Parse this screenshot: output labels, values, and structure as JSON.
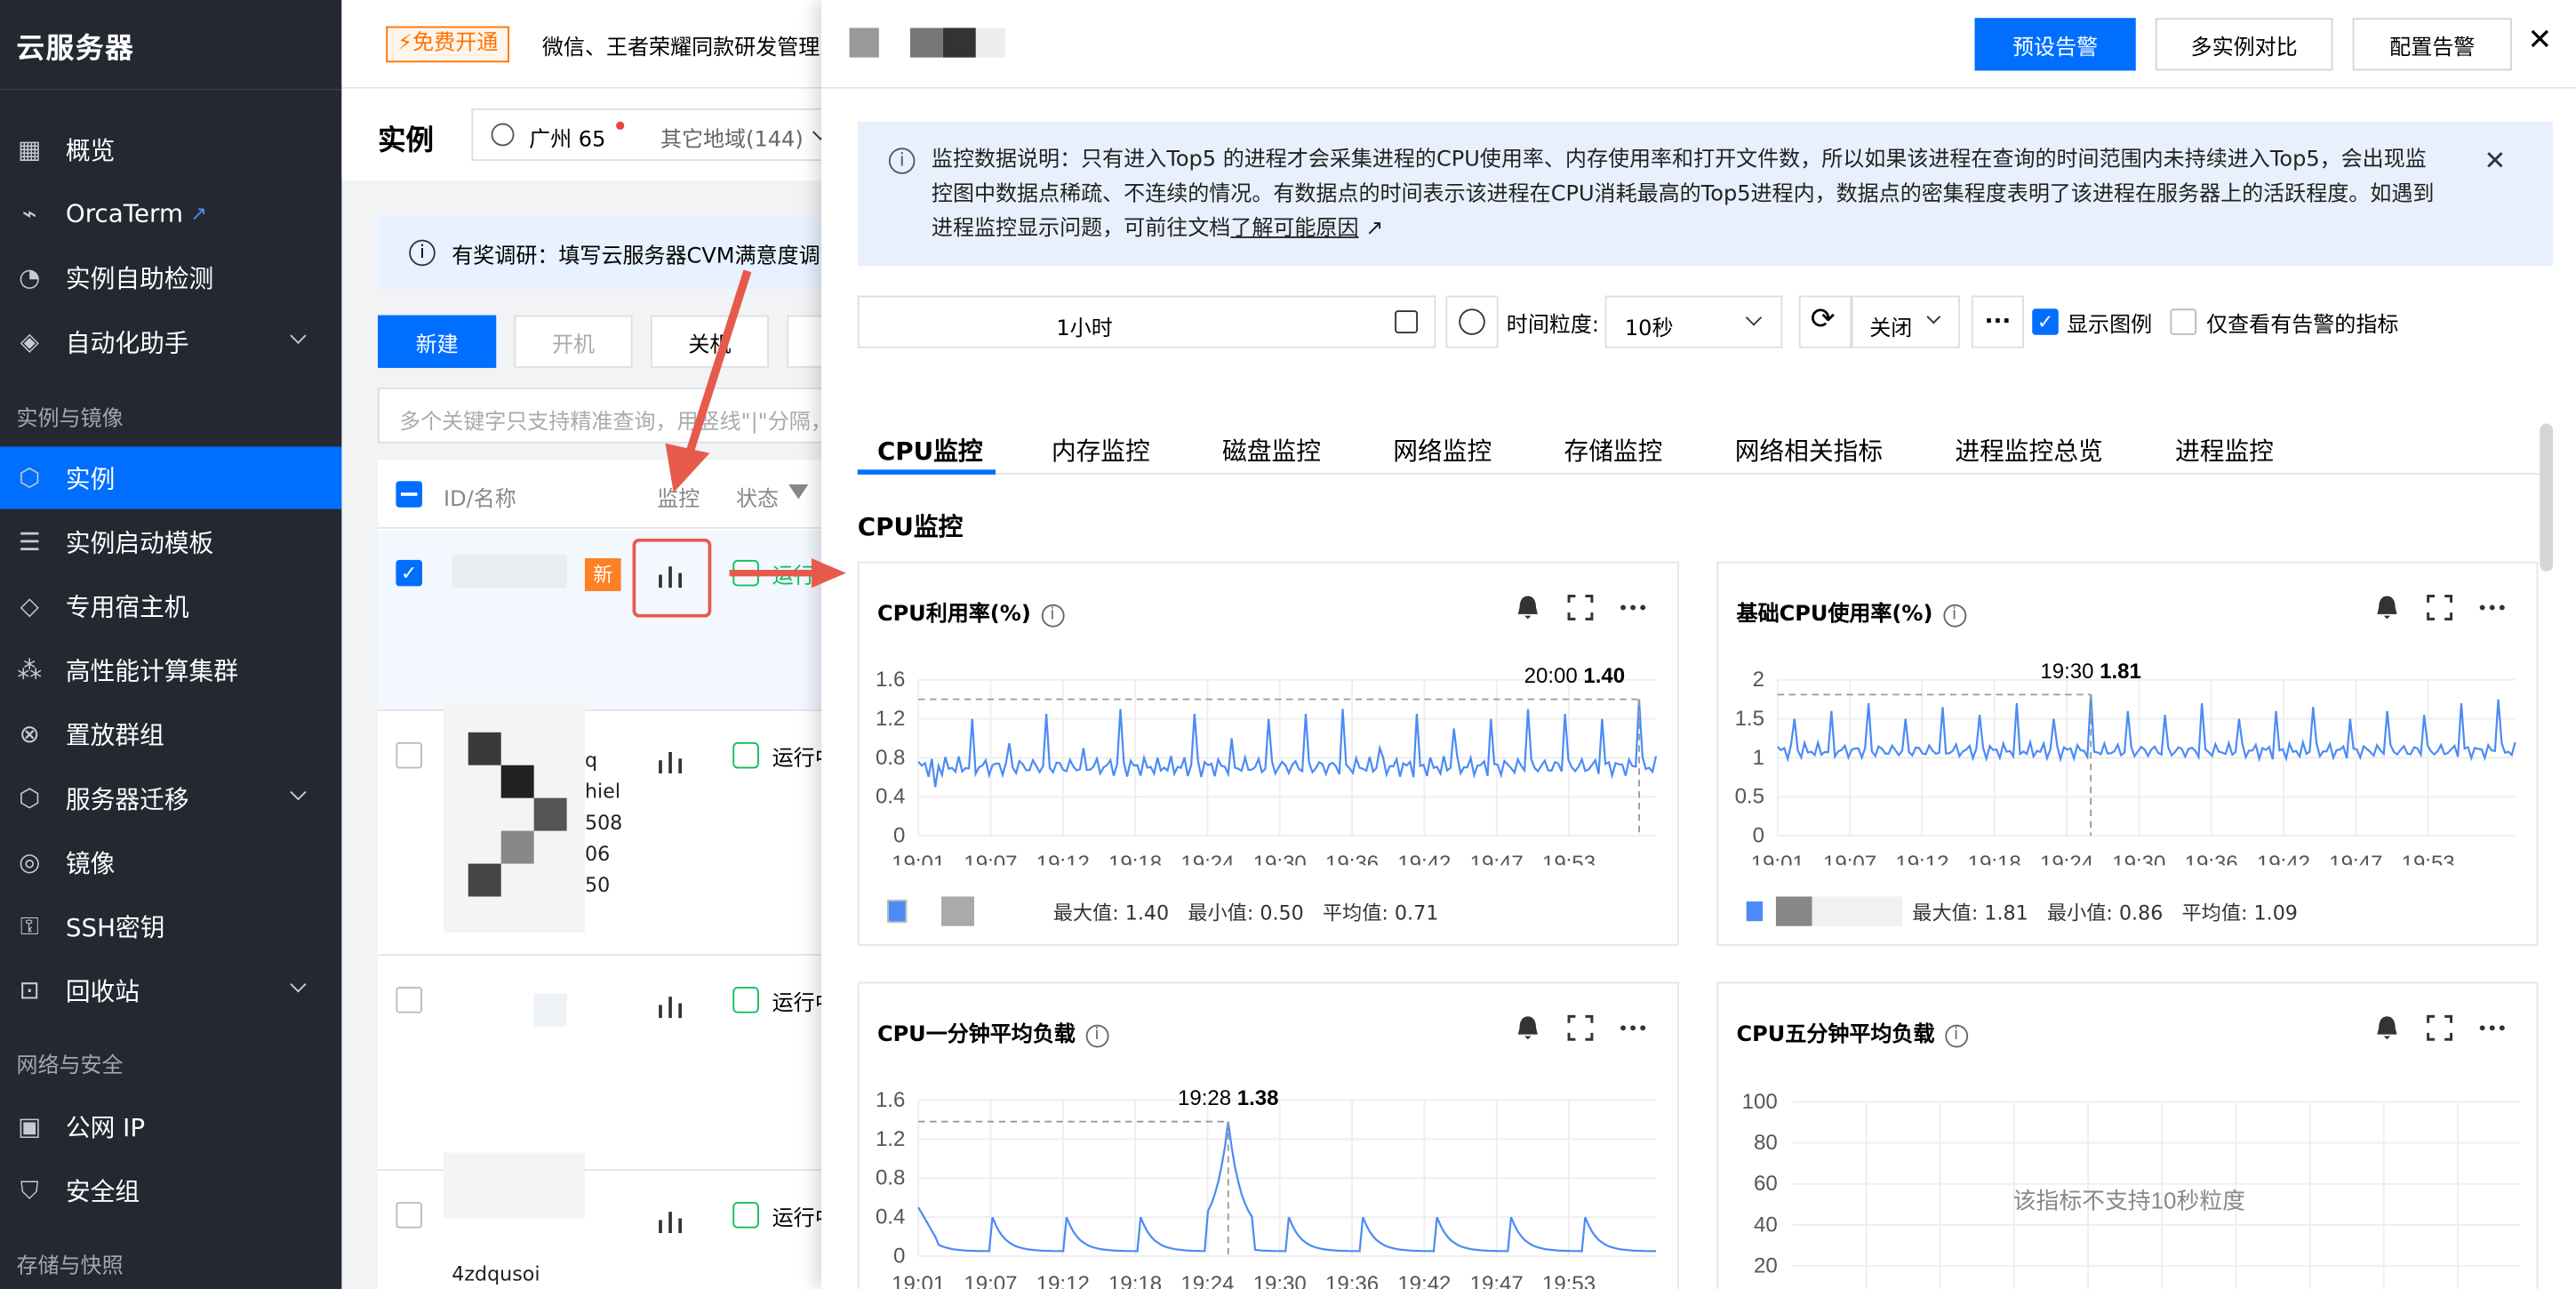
{
  "sidebar": {
    "brand": "云服务器",
    "items": [
      {
        "label": "概览",
        "icon": "grid-icon",
        "top": 72
      },
      {
        "label": "OrcaTerm",
        "icon": "terminal-icon",
        "top": 111
      },
      {
        "label": "实例自助检测",
        "icon": "check-icon",
        "top": 150
      },
      {
        "label": "自动化助手",
        "icon": "robot-icon",
        "top": 189
      },
      {
        "label": "实例",
        "icon": "cube-icon",
        "top": 272
      },
      {
        "label": "实例启动模板",
        "icon": "template-icon",
        "top": 311
      },
      {
        "label": "专用宿主机",
        "icon": "host-icon",
        "top": 350
      },
      {
        "label": "高性能计算集群",
        "icon": "cluster-icon",
        "top": 389
      },
      {
        "label": "置放群组",
        "icon": "group-icon",
        "top": 428
      },
      {
        "label": "服务器迁移",
        "icon": "migrate-icon",
        "top": 467
      },
      {
        "label": "镜像",
        "icon": "disc-icon",
        "top": 506
      },
      {
        "label": "SSH密钥",
        "icon": "key-icon",
        "top": 545
      },
      {
        "label": "回收站",
        "icon": "trash-icon",
        "top": 584
      },
      {
        "label": "公网 IP",
        "icon": "ip-icon",
        "top": 667
      },
      {
        "label": "安全组",
        "icon": "shield-icon",
        "top": 706
      }
    ],
    "sections": [
      "实例与镜像",
      "网络与安全",
      "存储与快照"
    ]
  },
  "middle": {
    "promo_badge": "免费开通",
    "promo_text": "微信、王者荣耀同款研发管理...",
    "page_title": "实例",
    "region": "广州 65",
    "other_region": "其它地域(144)",
    "notice": "有奖调研：填写云服务器CVM满意度调",
    "btn_new": "新建",
    "btn_start": "开机",
    "btn_stop": "关机",
    "search_placeholder": "多个关键字只支持精准查询，用竖线\"|\"分隔，",
    "col_id": "ID/名称",
    "col_monitor": "监控",
    "col_status": "状态",
    "new_badge": "新",
    "status_running": "运行中",
    "row_snippets": [
      "q",
      "hiel",
      "508",
      "06",
      "50"
    ],
    "row_bottom": "4zdqusoi"
  },
  "panel": {
    "btn_alarm": "预设告警",
    "btn_compare": "多实例对比",
    "btn_config": "配置告警",
    "info_text_1": "监控数据说明：只有进入Top5 的进程才会采集进程的CPU使用率、内存使用率和打开文件数，所以如果该进程在查询的时间范围内未持续进入Top5，会出现监",
    "info_text_2": "控图中数据点稀疏、不连续的情况。有数据点的时间表示该进程在CPU消耗最高的Top5进程内，数据点的密集程度表明了该进程在服务器上的活跃程度。如遇到",
    "info_text_3": "进程监控显示问题，可前往文档",
    "info_link": "了解可能原因",
    "time_range": "1小时",
    "granularity_label": "时间粒度:",
    "granularity_value": "10秒",
    "refresh_value": "关闭",
    "more": "···",
    "show_legend": "显示图例",
    "only_alarm": "仅查看有告警的指标",
    "tabs": [
      "CPU监控",
      "内存监控",
      "磁盘监控",
      "网络监控",
      "存储监控",
      "网络相关指标",
      "进程监控总览",
      "进程监控"
    ],
    "section_title": "CPU监控"
  },
  "cards": [
    {
      "title": "CPU利用率(%)",
      "stats": "最大值: 1.40   最小值: 0.50   平均值: 0.71",
      "tooltip_time": "20:00",
      "tooltip_value": "1.40"
    },
    {
      "title": "基础CPU使用率(%)",
      "stats": "最大值: 1.81   最小值: 0.86   平均值: 1.09",
      "tooltip_time": "19:30",
      "tooltip_value": "1.81"
    },
    {
      "title": "CPU一分钟平均负载",
      "tooltip_time": "19:28",
      "tooltip_value": "1.38"
    },
    {
      "title": "CPU五分钟平均负载",
      "unsupported": "该指标不支持10秒粒度"
    }
  ],
  "chart_data": [
    {
      "type": "line",
      "title": "CPU利用率(%)",
      "x_ticks": [
        "19:01",
        "19:07",
        "19:12",
        "19:18",
        "19:24",
        "19:30",
        "19:36",
        "19:42",
        "19:47",
        "19:53"
      ],
      "y_ticks": [
        "1.6",
        "1.2",
        "0.8",
        "0.4",
        "0"
      ],
      "ylim": [
        0,
        1.6
      ],
      "baseline": 0.71,
      "spikes": [
        0.5,
        1.2,
        0.95,
        1.25,
        0.9,
        1.3,
        0.8,
        1.25,
        1.0,
        1.2,
        1.25,
        1.3,
        0.9,
        1.25,
        1.1,
        1.2,
        1.3,
        1.25,
        1.2,
        1.4
      ],
      "color": "#4c8bf5"
    },
    {
      "type": "line",
      "title": "基础CPU使用率(%)",
      "x_ticks": [
        "19:01",
        "19:07",
        "19:12",
        "19:18",
        "19:24",
        "19:30",
        "19:36",
        "19:42",
        "19:47",
        "19:53"
      ],
      "y_ticks": [
        "2",
        "1.5",
        "1",
        "0.5",
        "0"
      ],
      "ylim": [
        0,
        2
      ],
      "baseline": 1.09,
      "spikes": [
        1.5,
        1.6,
        1.7,
        1.5,
        1.65,
        1.55,
        1.7,
        1.5,
        1.81,
        1.6,
        1.55,
        1.7,
        1.5,
        1.6,
        1.65,
        1.5,
        1.6,
        1.55,
        1.7,
        1.75
      ],
      "color": "#4c8bf5"
    },
    {
      "type": "line",
      "title": "CPU一分钟平均负载",
      "x_ticks": [
        "19:01",
        "19:07",
        "19:12",
        "19:18",
        "19:24",
        "19:30",
        "19:36",
        "19:42",
        "19:47",
        "19:53"
      ],
      "y_ticks": [
        "1.6",
        "1.2",
        "0.8",
        "0.4",
        "0"
      ],
      "ylim": [
        0,
        1.6
      ],
      "peak": 1.38,
      "color": "#4c8bf5"
    }
  ],
  "colors": {
    "sidebar": "#232831",
    "accent": "#006eff",
    "highlight": "#e65a4b",
    "line": "#4c8bf5"
  }
}
